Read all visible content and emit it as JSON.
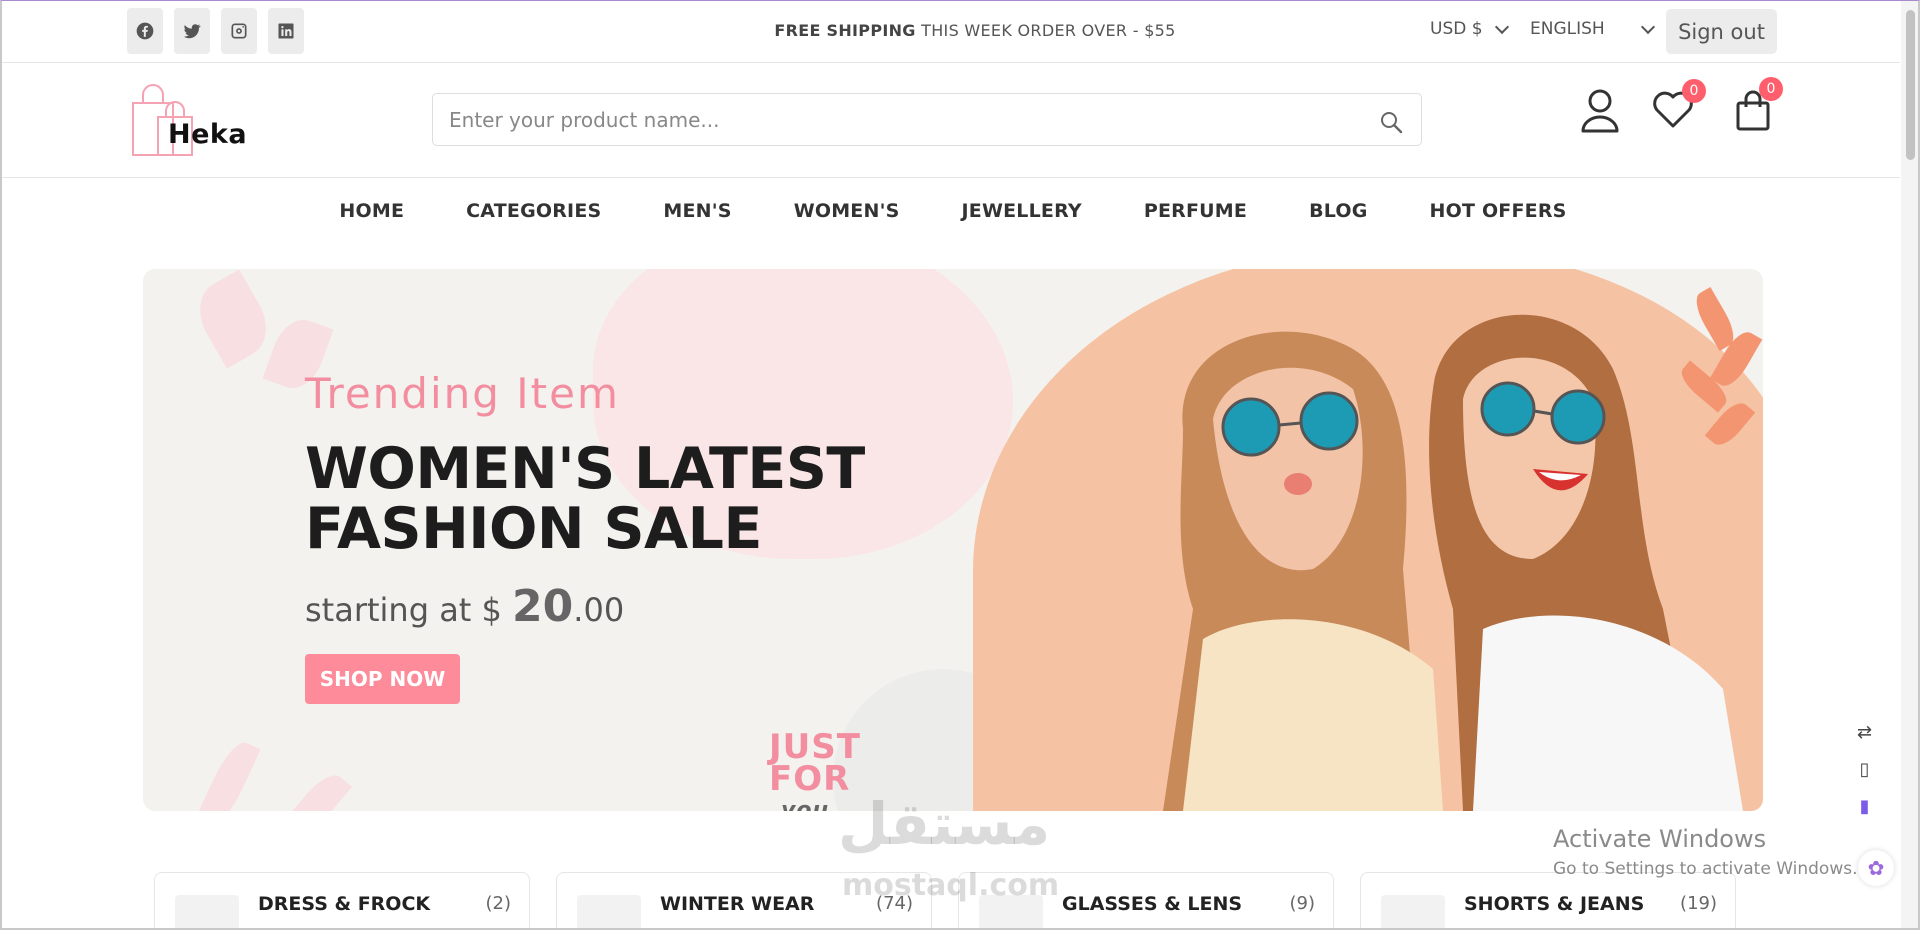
{
  "topbar": {
    "socials": [
      "facebook-icon",
      "twitter-icon",
      "instagram-icon",
      "linkedin-icon"
    ],
    "shipping_bold": "FREE SHIPPING",
    "shipping_rest": "THIS WEEK ORDER OVER - $55",
    "currency": "USD $",
    "language": "ENGLISH",
    "signout": "Sign out"
  },
  "header": {
    "logo_text": "Heka",
    "search_placeholder": "Enter your product name...",
    "wishlist_count": "0",
    "cart_count": "0",
    "icons": [
      "user-icon",
      "heart-icon",
      "shopping-bag-icon"
    ]
  },
  "nav": [
    "HOME",
    "CATEGORIES",
    "MEN'S",
    "WOMEN'S",
    "JEWELLERY",
    "PERFUME",
    "BLOG",
    "HOT OFFERS"
  ],
  "hero": {
    "subtitle": "Trending Item",
    "title_line1": "WOMEN'S LATEST",
    "title_line2": "FASHION SALE",
    "price_prefix": "starting at $",
    "price_whole": "20",
    "price_cents": ".00",
    "cta": "SHOP NOW",
    "stamp_line1": "JUST",
    "stamp_line2": "FOR",
    "stamp_line3": "you"
  },
  "categories": [
    {
      "name": "DRESS & FROCK",
      "count": "(2)"
    },
    {
      "name": "WINTER WEAR",
      "count": "(74)"
    },
    {
      "name": "GLASSES & LENS",
      "count": "(9)"
    },
    {
      "name": "SHORTS & JEANS",
      "count": "(19)"
    }
  ],
  "watermark": {
    "arabic": "مستقل",
    "latin": "mostaql.com"
  },
  "activate": {
    "line1": "Activate Windows",
    "line2": "Go to Settings to activate Windows."
  },
  "colors": {
    "accent": "#fe8b9a",
    "badge": "#ff5f6d",
    "hero_bg": "#f4f2ee",
    "peach": "#f5c3a3"
  }
}
